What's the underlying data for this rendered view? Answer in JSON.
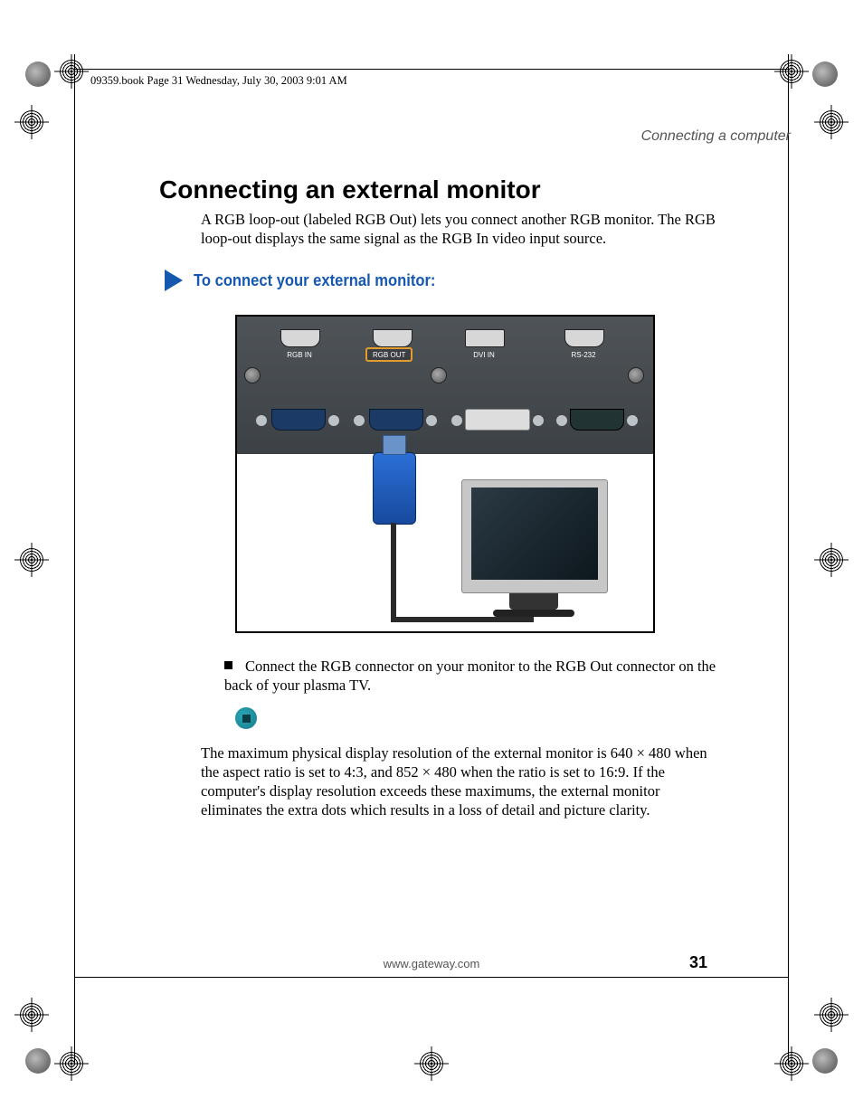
{
  "runhead": "09359.book  Page 31  Wednesday, July 30, 2003  9:01 AM",
  "section_header": "Connecting a computer",
  "title": "Connecting an external monitor",
  "intro": "A RGB loop-out (labeled RGB Out) lets you connect another RGB monitor. The RGB loop-out displays the same signal as the RGB In video input source.",
  "subhead": "To connect your external monitor:",
  "ports": {
    "rgb_in": "RGB IN",
    "rgb_out": "RGB OUT",
    "dvi_in": "DVI IN",
    "rs232": "RS-232"
  },
  "bullet": "Connect the RGB connector on your monitor to the RGB Out connector on the back of your plasma TV.",
  "note": "The maximum physical display resolution of the external monitor is 640 × 480 when the aspect ratio is set to 4:3, and 852 × 480 when the ratio is set to 16:9. If the computer's display resolution exceeds these maximums, the external monitor eliminates the extra dots which results in a loss of detail and picture clarity.",
  "footer_url": "www.gateway.com",
  "page_number": "31"
}
